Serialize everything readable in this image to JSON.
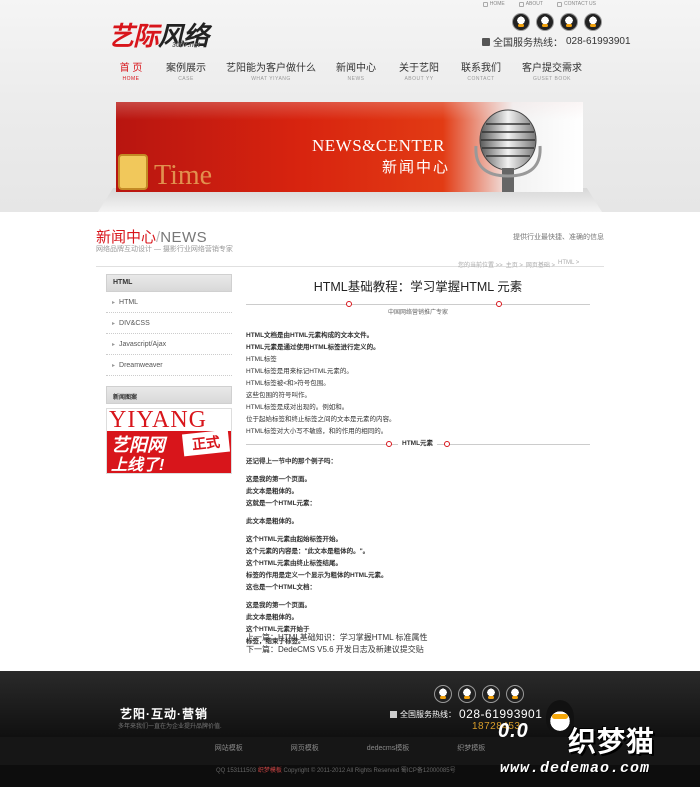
{
  "top_links": [
    "HOME",
    "ABOUT",
    "CONTACT US"
  ],
  "logo": {
    "text_red": "艺际",
    "text_black": "风络",
    "sub": "3007.net"
  },
  "hotline": {
    "label": "全国服务热线：",
    "number": "028-61993901"
  },
  "nav": [
    {
      "cn": "首 页",
      "en": "HOME",
      "active": true
    },
    {
      "cn": "案例展示",
      "en": "CASE"
    },
    {
      "cn": "艺阳能为客户做什么",
      "en": "WHAT YIYANG"
    },
    {
      "cn": "新闻中心",
      "en": "NEWS"
    },
    {
      "cn": "关于艺阳",
      "en": "ABOUT YY"
    },
    {
      "cn": "联系我们",
      "en": "CONTACT"
    },
    {
      "cn": "客户提交需求",
      "en": "GUSET BOOK"
    }
  ],
  "banner": {
    "en": "NEWS&CENTER",
    "cn": "新闻中心",
    "time": "Time"
  },
  "section": {
    "title_cn": "新闻中心",
    "title_en": "NEWS",
    "subtitle": "网络品牌互动设计 — 摄影行业网络营销专家",
    "right_text": "提供行业最快捷、准确的信息"
  },
  "breadcrumb": [
    "您的当前位置 >>",
    "主页 >",
    "网页基础 >",
    "HTML >"
  ],
  "sidebar": {
    "head": "HTML",
    "items": [
      "HTML",
      "DIV&CSS",
      "Javascript/Ajax",
      "Dreamweaver"
    ],
    "pic_head": "新闻图案",
    "pic": {
      "yiyang": "YIYANG",
      "l1": "艺阳网",
      "l2": "上线了!",
      "tag": "正式"
    }
  },
  "article": {
    "title": "HTML基础教程：学习掌握HTML 元素",
    "source": "中国网络营销推广专家",
    "p1": [
      "HTML文档是由HTML元素构成的文本文件。",
      "HTML元素是通过使用HTML标签进行定义的。",
      "HTML标签",
      "HTML标签是用来标记HTML元素的。",
      "HTML标签被<和>符号包围。",
      "这些包围的符号叫作。",
      "HTML标签是成对出现的。例如和。",
      "位于起始标签和终止标签之间的文本是元素的内容。",
      "HTML标签对大小写不敏感，和的作用的相同的。"
    ],
    "mid_head": "HTML元素",
    "p2": [
      "还记得上一节中的那个例子吗：",
      "",
      "这是我的第一个页面。",
      "此文本是粗体的。",
      "这就是一个HTML元素：",
      "",
      "此文本是粗体的。",
      "",
      "这个HTML元素由起始标签开始。",
      "这个元素的内容是：\"此文本是粗体的。\"。",
      "这个HTML元素由终止标签结尾。",
      "标签的作用是定义一个显示为粗体的HTML元素。",
      "这也是一个HTML文档：",
      "",
      "这是我的第一个页面。",
      "此文本是粗体的。",
      "这个HTML元素开始于",
      "标签，结束于标签。"
    ],
    "prev": "上一篇：HTML基础知识：学习掌握HTML 标准属性",
    "next": "下一篇：DedeCMS V5.6 开发日志及新建议提交贴"
  },
  "footer": {
    "slogan": "艺阳·互动·营销",
    "slogan_sub": "多年来我们一直在为企业提升品牌价值.",
    "hot_label": "全国服务热线：",
    "hot_number": "028-61993901",
    "number2": "18728453",
    "links": [
      "网站模板",
      "网页模板",
      "dedecms模板",
      "织梦模板"
    ],
    "copyright_a": "QQ 153111503",
    "copyright_red": "织梦模板",
    "copyright_b": "Copyright © 2011-2012 All Rights Reserved 蜀ICP备12000085号"
  },
  "watermark": {
    "oo": "0.0",
    "cn": "织梦猫",
    "url": "www.dedemao.com"
  }
}
